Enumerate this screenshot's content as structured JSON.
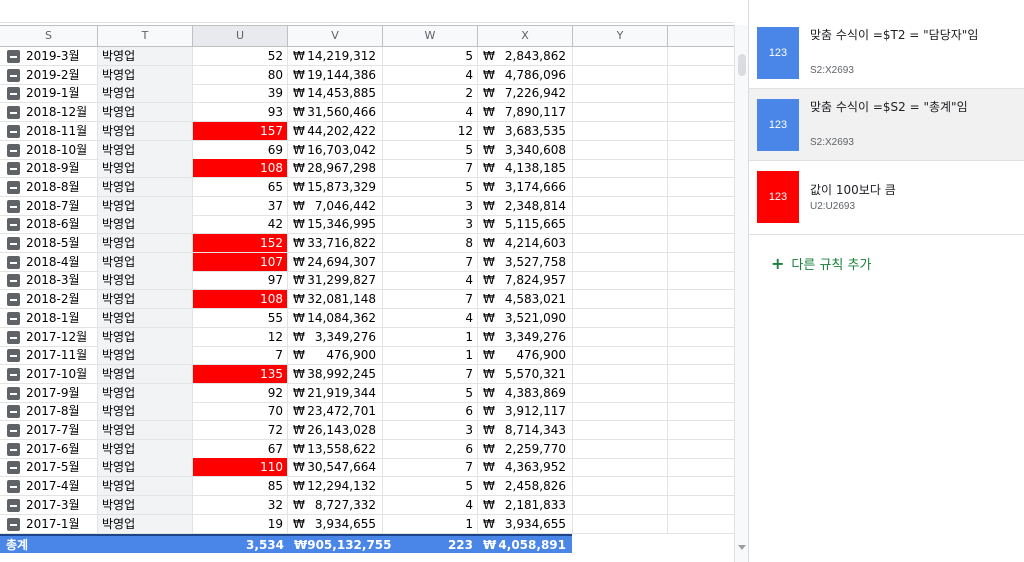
{
  "columns": [
    "S",
    "T",
    "U",
    "V",
    "W",
    "X",
    "Y"
  ],
  "rows": [
    {
      "month": "2019-3월",
      "rep": "박영업",
      "count": "52",
      "amount": "14,219,312",
      "n": "5",
      "avg": "2,843,862",
      "hl": false
    },
    {
      "month": "2019-2월",
      "rep": "박영업",
      "count": "80",
      "amount": "19,144,386",
      "n": "4",
      "avg": "4,786,096",
      "hl": false
    },
    {
      "month": "2019-1월",
      "rep": "박영업",
      "count": "39",
      "amount": "14,453,885",
      "n": "2",
      "avg": "7,226,942",
      "hl": false
    },
    {
      "month": "2018-12월",
      "rep": "박영업",
      "count": "93",
      "amount": "31,560,466",
      "n": "4",
      "avg": "7,890,117",
      "hl": false
    },
    {
      "month": "2018-11월",
      "rep": "박영업",
      "count": "157",
      "amount": "44,202,422",
      "n": "12",
      "avg": "3,683,535",
      "hl": true
    },
    {
      "month": "2018-10월",
      "rep": "박영업",
      "count": "69",
      "amount": "16,703,042",
      "n": "5",
      "avg": "3,340,608",
      "hl": false
    },
    {
      "month": "2018-9월",
      "rep": "박영업",
      "count": "108",
      "amount": "28,967,298",
      "n": "7",
      "avg": "4,138,185",
      "hl": true
    },
    {
      "month": "2018-8월",
      "rep": "박영업",
      "count": "65",
      "amount": "15,873,329",
      "n": "5",
      "avg": "3,174,666",
      "hl": false
    },
    {
      "month": "2018-7월",
      "rep": "박영업",
      "count": "37",
      "amount": "7,046,442",
      "n": "3",
      "avg": "2,348,814",
      "hl": false
    },
    {
      "month": "2018-6월",
      "rep": "박영업",
      "count": "42",
      "amount": "15,346,995",
      "n": "3",
      "avg": "5,115,665",
      "hl": false
    },
    {
      "month": "2018-5월",
      "rep": "박영업",
      "count": "152",
      "amount": "33,716,822",
      "n": "8",
      "avg": "4,214,603",
      "hl": true
    },
    {
      "month": "2018-4월",
      "rep": "박영업",
      "count": "107",
      "amount": "24,694,307",
      "n": "7",
      "avg": "3,527,758",
      "hl": true
    },
    {
      "month": "2018-3월",
      "rep": "박영업",
      "count": "97",
      "amount": "31,299,827",
      "n": "4",
      "avg": "7,824,957",
      "hl": false
    },
    {
      "month": "2018-2월",
      "rep": "박영업",
      "count": "108",
      "amount": "32,081,148",
      "n": "7",
      "avg": "4,583,021",
      "hl": true
    },
    {
      "month": "2018-1월",
      "rep": "박영업",
      "count": "55",
      "amount": "14,084,362",
      "n": "4",
      "avg": "3,521,090",
      "hl": false
    },
    {
      "month": "2017-12월",
      "rep": "박영업",
      "count": "12",
      "amount": "3,349,276",
      "n": "1",
      "avg": "3,349,276",
      "hl": false
    },
    {
      "month": "2017-11월",
      "rep": "박영업",
      "count": "7",
      "amount": "476,900",
      "n": "1",
      "avg": "476,900",
      "hl": false
    },
    {
      "month": "2017-10월",
      "rep": "박영업",
      "count": "135",
      "amount": "38,992,245",
      "n": "7",
      "avg": "5,570,321",
      "hl": true
    },
    {
      "month": "2017-9월",
      "rep": "박영업",
      "count": "92",
      "amount": "21,919,344",
      "n": "5",
      "avg": "4,383,869",
      "hl": false
    },
    {
      "month": "2017-8월",
      "rep": "박영업",
      "count": "70",
      "amount": "23,472,701",
      "n": "6",
      "avg": "3,912,117",
      "hl": false
    },
    {
      "month": "2017-7월",
      "rep": "박영업",
      "count": "72",
      "amount": "26,143,028",
      "n": "3",
      "avg": "8,714,343",
      "hl": false
    },
    {
      "month": "2017-6월",
      "rep": "박영업",
      "count": "67",
      "amount": "13,558,622",
      "n": "6",
      "avg": "2,259,770",
      "hl": false
    },
    {
      "month": "2017-5월",
      "rep": "박영업",
      "count": "110",
      "amount": "30,547,664",
      "n": "7",
      "avg": "4,363,952",
      "hl": true
    },
    {
      "month": "2017-4월",
      "rep": "박영업",
      "count": "85",
      "amount": "12,294,132",
      "n": "5",
      "avg": "2,458,826",
      "hl": false
    },
    {
      "month": "2017-3월",
      "rep": "박영업",
      "count": "32",
      "amount": "8,727,332",
      "n": "4",
      "avg": "2,181,833",
      "hl": false
    },
    {
      "month": "2017-1월",
      "rep": "박영업",
      "count": "19",
      "amount": "3,934,655",
      "n": "1",
      "avg": "3,934,655",
      "hl": false
    }
  ],
  "currency": "₩",
  "total": {
    "label": "총계",
    "count": "3,534",
    "amount": "₩905,132,755",
    "n": "223",
    "avg": "4,058,891"
  },
  "panel": {
    "rules": [
      {
        "sample": "123",
        "text": "맞춤 수식이 =$T2 = \"담당자\"임",
        "range": "S2:X2693",
        "color": "#4a86e8",
        "shaded": false
      },
      {
        "sample": "123",
        "text": "맞춤 수식이 =$S2 = \"총계\"임",
        "range": "S2:X2693",
        "color": "#4a86e8",
        "shaded": true
      },
      {
        "sample": "123",
        "text": "값이 100보다 큼",
        "range": "U2:U2693",
        "color": "#ff0000",
        "shaded": false
      }
    ],
    "add_rule_label": "다른 규칙 추가"
  },
  "colors": {
    "highlight": "#ff0000",
    "total_bg": "#4a86e8",
    "add_rule": "#188038"
  }
}
